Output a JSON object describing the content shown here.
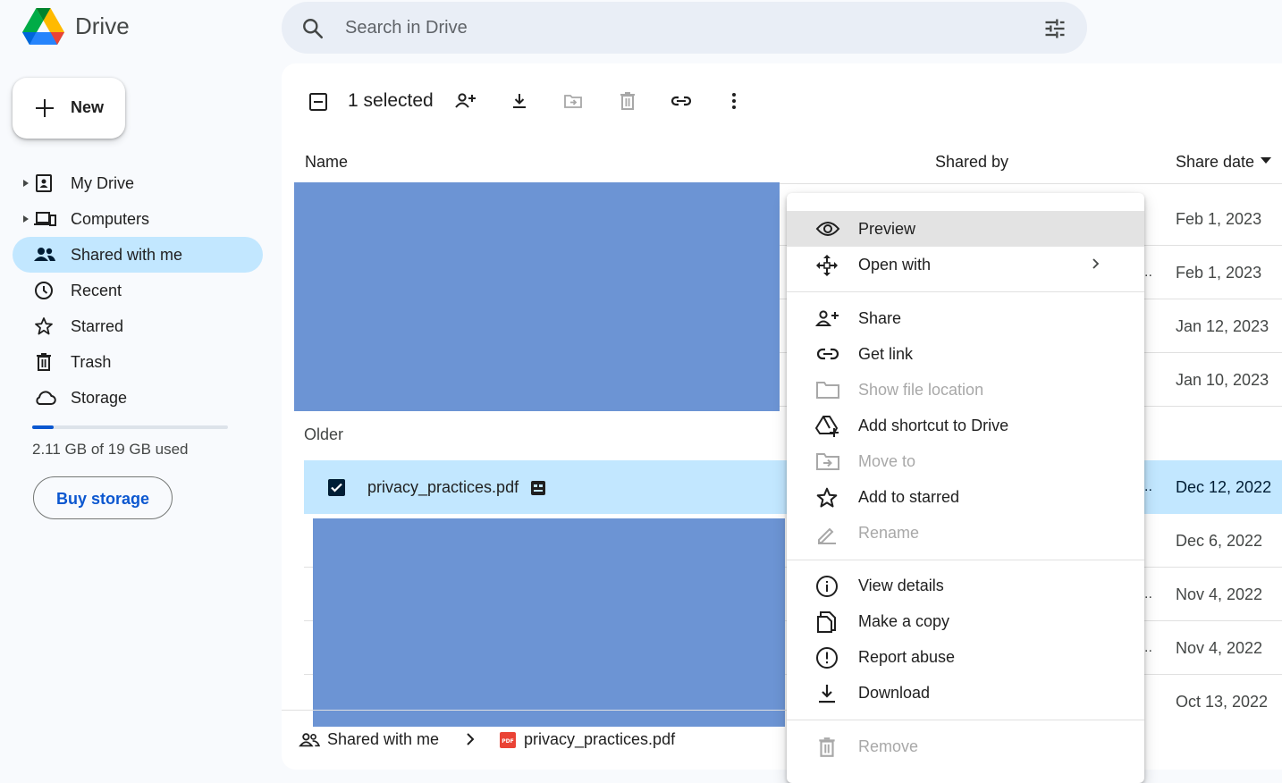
{
  "app": {
    "brand": "Drive"
  },
  "search": {
    "placeholder": "Search in Drive"
  },
  "sidebar": {
    "new_label": "New",
    "items": [
      {
        "label": "My Drive",
        "icon": "my-drive-icon"
      },
      {
        "label": "Computers",
        "icon": "computers-icon"
      },
      {
        "label": "Shared with me",
        "icon": "shared-icon",
        "active": true
      },
      {
        "label": "Recent",
        "icon": "clock-icon"
      },
      {
        "label": "Starred",
        "icon": "star-icon"
      },
      {
        "label": "Trash",
        "icon": "trash-icon"
      },
      {
        "label": "Storage",
        "icon": "cloud-icon"
      }
    ],
    "storage": {
      "used_text": "2.11 GB of 19 GB used",
      "used_fraction": 0.111
    },
    "buy_label": "Buy storage"
  },
  "toolbar": {
    "selected_text": "1 selected"
  },
  "columns": {
    "name": "Name",
    "shared_by": "Shared by",
    "share_date": "Share date"
  },
  "rows_recent": [
    {
      "date": "Feb 1, 2023"
    },
    {
      "date": "Feb 1, 2023"
    },
    {
      "date": "Jan 12, 2023"
    },
    {
      "date": "Jan 10, 2023"
    }
  ],
  "group_older": "Older",
  "selected_file": {
    "name": "privacy_practices.pdf",
    "date": "Dec 12, 2022"
  },
  "rows_older": [
    {
      "date": "Dec 6, 2022"
    },
    {
      "date": "Nov 4, 2022"
    },
    {
      "date": "Nov 4, 2022"
    },
    {
      "date": "Oct 13, 2022"
    }
  ],
  "breadcrumb": {
    "root": "Shared with me",
    "file": "privacy_practices.pdf"
  },
  "menu": {
    "items": [
      {
        "label": "Preview",
        "icon": "eye-icon"
      },
      {
        "label": "Open with",
        "icon": "open-with-icon"
      },
      {
        "label": "Share",
        "icon": "add-person-icon"
      },
      {
        "label": "Get link",
        "icon": "link-icon"
      },
      {
        "label": "Show file location",
        "icon": "folder-icon"
      },
      {
        "label": "Add shortcut to Drive",
        "icon": "add-shortcut-icon"
      },
      {
        "label": "Move to",
        "icon": "move-to-icon"
      },
      {
        "label": "Add to starred",
        "icon": "star-icon"
      },
      {
        "label": "Rename",
        "icon": "pencil-icon"
      },
      {
        "label": "View details",
        "icon": "info-icon"
      },
      {
        "label": "Make a copy",
        "icon": "copy-icon"
      },
      {
        "label": "Report abuse",
        "icon": "report-icon"
      },
      {
        "label": "Download",
        "icon": "download-icon"
      },
      {
        "label": "Remove",
        "icon": "trash-icon"
      }
    ]
  },
  "colors": {
    "accent": "#0b57d0",
    "selected_bg": "#c2e7ff",
    "redaction": "#6c94d4"
  }
}
